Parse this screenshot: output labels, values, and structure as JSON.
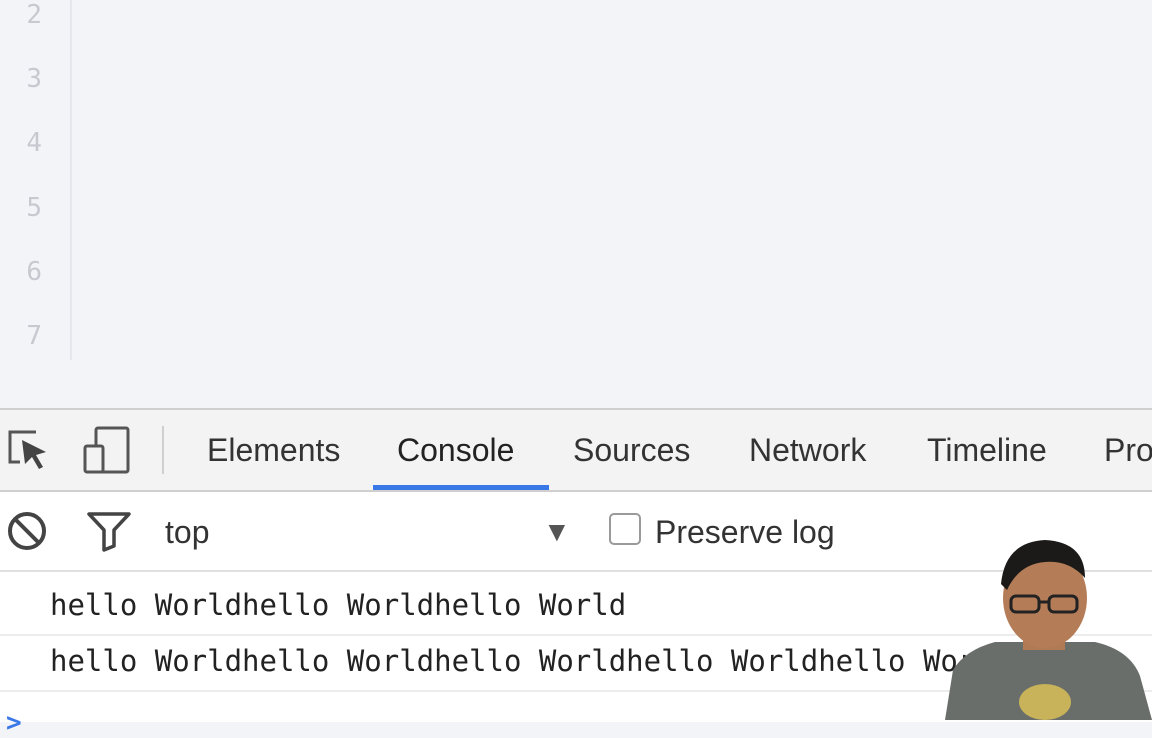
{
  "editor": {
    "line_numbers": [
      "2",
      "3",
      "4",
      "5",
      "6",
      "7"
    ]
  },
  "devtools": {
    "tabs": [
      {
        "label": "Elements",
        "active": false
      },
      {
        "label": "Console",
        "active": true
      },
      {
        "label": "Sources",
        "active": false
      },
      {
        "label": "Network",
        "active": false
      },
      {
        "label": "Timeline",
        "active": false
      },
      {
        "label": "Pro",
        "active": false
      }
    ],
    "icons": {
      "inspect": "inspect-element-icon",
      "device": "device-mode-icon",
      "clear": "clear-console-icon",
      "filter": "filter-icon"
    },
    "toolbar": {
      "context": "top",
      "preserve_log_label": "Preserve log",
      "preserve_log_checked": false
    },
    "console_output": [
      "hello Worldhello Worldhello World",
      "hello Worldhello Worldhello Worldhello Worldhello World"
    ],
    "accent_color": "#3b78e7"
  }
}
